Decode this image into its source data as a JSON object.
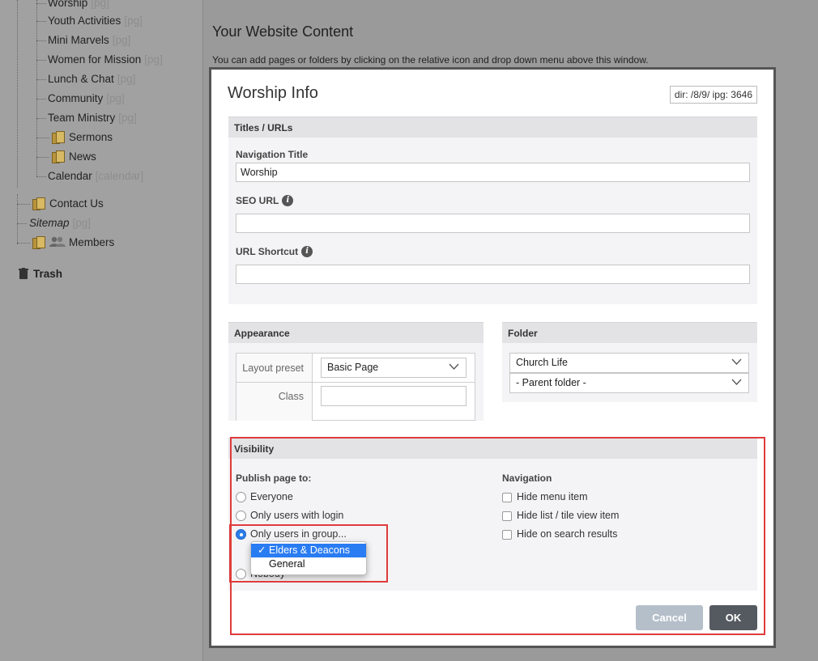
{
  "sidebar": {
    "items": [
      {
        "label": "Worship",
        "tag": "[pg]"
      },
      {
        "label": "Youth Activities",
        "tag": "[pg]"
      },
      {
        "label": "Mini Marvels",
        "tag": "[pg]"
      },
      {
        "label": "Women for Mission",
        "tag": "[pg]"
      },
      {
        "label": "Lunch & Chat",
        "tag": "[pg]"
      },
      {
        "label": "Community",
        "tag": "[pg]"
      },
      {
        "label": "Team Ministry",
        "tag": "[pg]"
      },
      {
        "label": "Sermons"
      },
      {
        "label": "News"
      },
      {
        "label": "Calendar",
        "tag": "[calendar]"
      },
      {
        "label": "Contact Us"
      },
      {
        "label": "Sitemap",
        "tag": "[pg]"
      },
      {
        "label": "Members"
      }
    ],
    "trash_label": "Trash"
  },
  "main": {
    "title": "Your Website Content",
    "description": "You can add pages or folders by clicking on the relative icon and drop down menu above this window."
  },
  "dialog": {
    "title": "Worship Info",
    "dir_info": "dir: /8/9/  ipg: 3646",
    "titles_section": {
      "header": "Titles / URLs",
      "nav_title_label": "Navigation Title",
      "nav_title_value": "Worship",
      "seo_url_label": "SEO URL",
      "seo_url_value": "",
      "url_shortcut_label": "URL Shortcut",
      "url_shortcut_value": ""
    },
    "appearance": {
      "header": "Appearance",
      "layout_preset_label": "Layout preset",
      "layout_preset_value": "Basic Page",
      "class_label": "Class",
      "class_value": ""
    },
    "folder": {
      "header": "Folder",
      "folder_value": "Church Life",
      "parent_value": "- Parent folder -"
    },
    "visibility": {
      "header": "Visibility",
      "publish_label": "Publish page to:",
      "options": [
        "Everyone",
        "Only users with login",
        "Only users in group...",
        "Nobody"
      ],
      "selected_option": 2,
      "group_dropdown": [
        "Elders & Deacons",
        "General"
      ],
      "group_selected": 0,
      "navigation_label": "Navigation",
      "nav_options": [
        "Hide menu item",
        "Hide list / tile view item",
        "Hide on search results"
      ]
    },
    "buttons": {
      "cancel": "Cancel",
      "ok": "OK"
    }
  },
  "colors": {
    "accent_blue": "#2a7cf2",
    "highlight_red": "#e03b3b",
    "ok_button": "#555a60",
    "cancel_button": "#b5bfca"
  }
}
